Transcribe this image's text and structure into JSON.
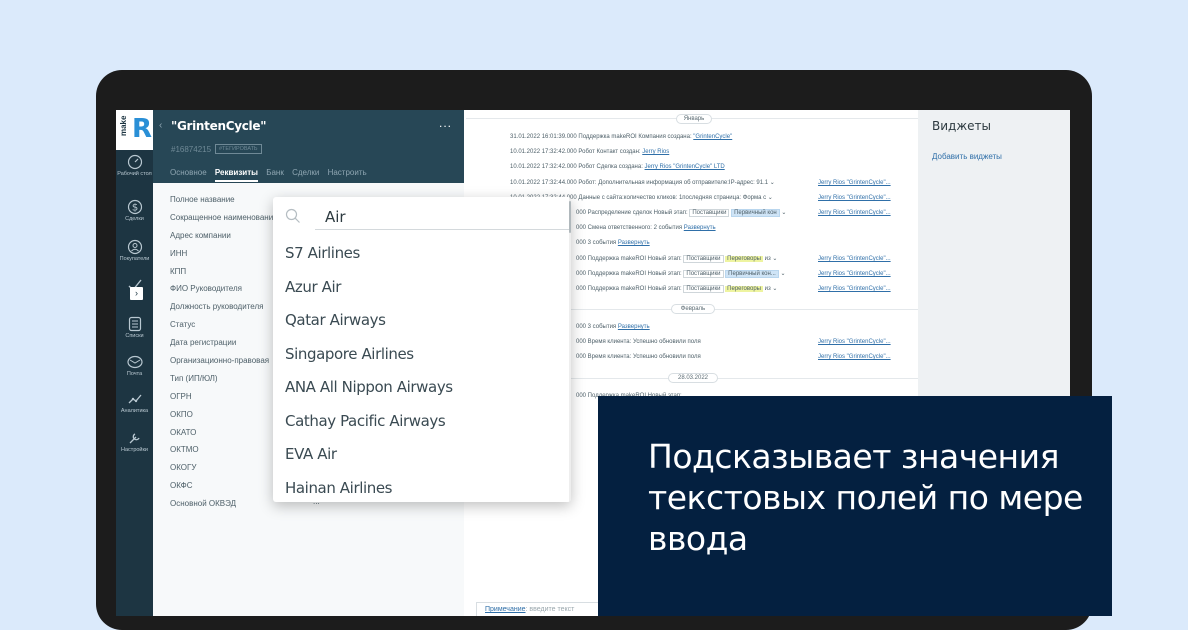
{
  "nav": {
    "items": [
      {
        "label": "Рабочий стол",
        "icon": "dashboard-icon"
      },
      {
        "label": "Сделки",
        "icon": "dollar-icon"
      },
      {
        "label": "Покупатели",
        "icon": "buyers-icon"
      },
      {
        "label": "",
        "icon": "tasks-icon"
      },
      {
        "label": "Списки",
        "icon": "lists-icon"
      },
      {
        "label": "Почта",
        "icon": "mail-icon"
      },
      {
        "label": "Аналитика",
        "icon": "analytics-icon"
      },
      {
        "label": "Настройки",
        "icon": "settings-icon"
      }
    ],
    "toggle": "›"
  },
  "card": {
    "title": "\"GrintenCycle\"",
    "back": "‹",
    "menu": "...",
    "id": "#16874215",
    "tag": "#ТЕГИРОВАТЬ",
    "tabs": [
      "Основное",
      "Реквизиты",
      "Банк",
      "Сделки",
      "Настроить"
    ],
    "active_tab": "Реквизиты",
    "fields": [
      "Полное название",
      "Сокращенное наименование",
      "Адрес компании",
      "ИНН",
      "КПП",
      "ФИО Руководителя",
      "Должность руководителя",
      "Статус",
      "Дата регистрации",
      "Организационно-правовая",
      "Тип (ИП/ЮЛ)",
      "ОГРН",
      "ОКПО",
      "ОКАТО",
      "ОКТМО",
      "ОКОГУ",
      "ОКФС",
      "Основной ОКВЭД"
    ],
    "last_value": "..."
  },
  "feed": {
    "months": [
      "Январь",
      "Февраль",
      "28.03.2022"
    ],
    "rows": [
      {
        "text": "31.01.2022 16:01:39.000 Поддержка makeROI Компания создана: ",
        "link": "\"GrintenCycle\"",
        "right": ""
      },
      {
        "text": "10.01.2022 17:32:42.000 Робот Контакт создан: ",
        "link": "Jerry Rios",
        "right": ""
      },
      {
        "text": "10.01.2022 17:32:42.000 Робот Сделка создана: ",
        "link": "Jerry Rios \"GrintenCycle\" LTD",
        "right": ""
      },
      {
        "text": "10.01.2022 17:32:44.000 Робот: Дополнительная информация об отправителе:IP-адрес: 91.1 ⌄",
        "link": "",
        "right": "Jerry Rios \"GrintenCycle\"..."
      },
      {
        "text": "10.01.2022 17:32:44.000 Данные с сайта:количество кликов: 1последняя страница: Форма с ⌄",
        "link": "",
        "right": "Jerry Rios \"GrintenCycle\"..."
      },
      {
        "text": "000 Распределение сделок Новый этап: ",
        "box": "Поставщики",
        "tag": "Первичный кон",
        "tag_color": "blue",
        "after": " ⌄",
        "right": "Jerry Rios \"GrintenCycle\"..."
      },
      {
        "text": "000 Смена ответственного: 2 события ",
        "link": "Развернуть",
        "right": ""
      },
      {
        "text": "000 3 события ",
        "link": "Развернуть",
        "right": ""
      },
      {
        "text": "000 Поддержка makeROI Новый этап: ",
        "box": "Поставщики",
        "tag": "Переговоры",
        "tag_color": "yellow",
        "after": " из ⌄",
        "right": "Jerry Rios \"GrintenCycle\"..."
      },
      {
        "text": "000 Поддержка makeROI Новый этап: ",
        "box": "Поставщики",
        "tag": "Первичный кон...",
        "tag_color": "blue",
        "after": " ⌄",
        "right": "Jerry Rios \"GrintenCycle\"..."
      },
      {
        "text": "000 Поддержка makeROI Новый этап: ",
        "box": "Поставщики",
        "tag": "Переговоры",
        "tag_color": "yellow",
        "after": " из ⌄",
        "right": "Jerry Rios \"GrintenCycle\"..."
      },
      {
        "text": "000 3 события ",
        "link": "Развернуть",
        "right": ""
      },
      {
        "text": "000 Время клиента: Успешно обновили поля",
        "link": "",
        "right": "Jerry Rios \"GrintenCycle\"..."
      },
      {
        "text": "000 Время клиента: Успешно обновили поля",
        "link": "",
        "right": "Jerry Rios \"GrintenCycle\"..."
      },
      {
        "text": "000 Поддержка makeROI Новый этап:",
        "link": "",
        "right": ""
      }
    ],
    "note_label": "Примечание",
    "note_placeholder": ": введите текст"
  },
  "widgets": {
    "title": "Виджеты",
    "add_label": "Добавить виджеты"
  },
  "dropdown": {
    "query": "Air",
    "suggestions": [
      "S7 Airlines",
      "Azur Air",
      "Qatar Airways",
      "Singapore Airlines",
      "ANA All Nippon Airways",
      "Cathay Pacific Airways",
      "EVA Air",
      "Hainan Airlines"
    ]
  },
  "banner": {
    "text": "Подсказывает значения текстовых полей по мере ввода"
  }
}
